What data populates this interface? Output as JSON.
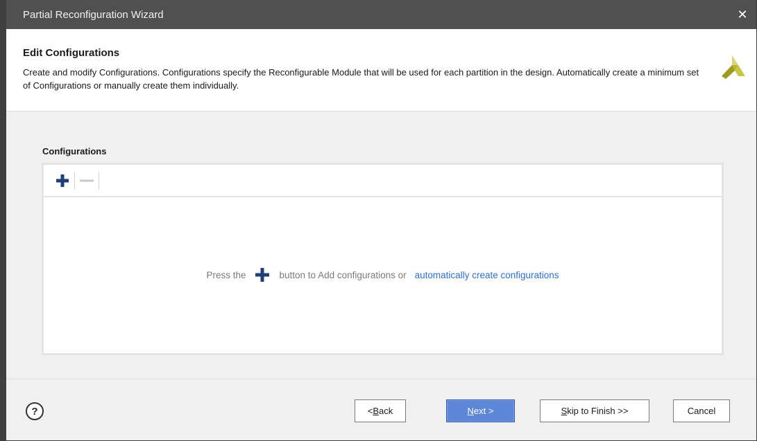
{
  "window": {
    "title": "Partial Reconfiguration Wizard",
    "close_glyph": "✕"
  },
  "header": {
    "title": "Edit Configurations",
    "description": "Create and modify Configurations. Configurations specify the Reconfigurable Module that will be used for each partition in the design. Automatically create a minimum set of Configurations or manually create them individually.",
    "logo_icon": "xilinx-logo-icon"
  },
  "configurations": {
    "label": "Configurations",
    "toolbar": {
      "add_icon": "plus-icon",
      "remove_icon": "minus-icon"
    },
    "empty_message": {
      "prefix": "Press the",
      "suffix": "button to Add configurations or",
      "link": "automatically create configurations"
    }
  },
  "footer": {
    "help_label": "?",
    "back": {
      "pre": "< ",
      "key": "B",
      "rest": "ack"
    },
    "next": {
      "key": "N",
      "rest": "ext >"
    },
    "skip": {
      "key": "S",
      "rest": "kip to Finish >>"
    },
    "cancel": "Cancel"
  },
  "colors": {
    "titlebar": "#505050",
    "accent_plus": "#1f3f7a",
    "link": "#2a6fd6",
    "primary_button": "#5c86d6",
    "logo": "#b9b62c"
  }
}
